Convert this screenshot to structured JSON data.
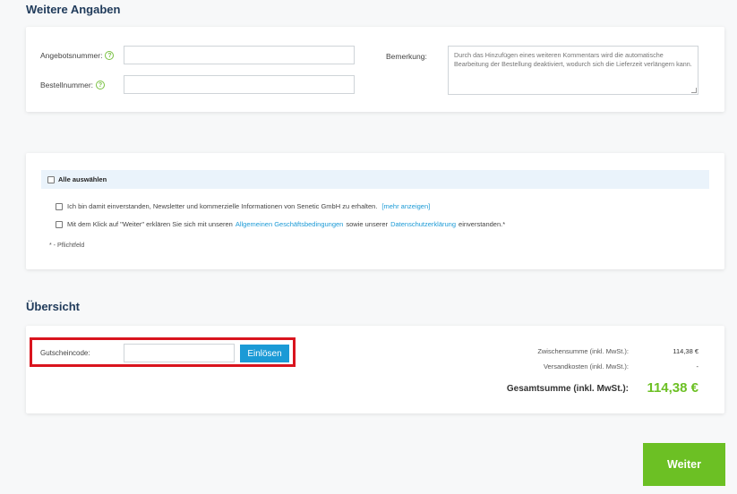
{
  "additional_info": {
    "title": "Weitere Angaben",
    "offer_number_label": "Angebotsnummer:",
    "order_number_label": "Bestellnummer:",
    "help_glyph": "?",
    "remark_label": "Bemerkung:",
    "remark_placeholder": "Durch das Hinzufügen eines weiteren Kommentars wird die automatische Bearbeitung der Bestellung deaktiviert, wodurch sich die Lieferzeit verlängern kann."
  },
  "consents": {
    "select_all": "Alle auswählen",
    "newsletter_text": "Ich bin damit einverstanden, Newsletter und kommerzielle Informationen von Senetic GmbH zu erhalten.",
    "newsletter_more": "[mehr anzeigen]",
    "terms_prefix": "Mit dem Klick auf \"Weiter\" erklären Sie sich mit unseren",
    "terms_link": "Allgemeinen Geschäftsbedingungen",
    "terms_middle": "sowie unserer",
    "privacy_link": "Datenschutzerklärung",
    "terms_suffix": "einverstanden.*",
    "required_note": "* - Pflichtfeld"
  },
  "overview": {
    "title": "Übersicht",
    "voucher_label": "Gutscheincode:",
    "redeem_button": "Einlösen",
    "subtotal_label": "Zwischensumme (inkl. MwSt.):",
    "subtotal_value": "114,38 €",
    "shipping_label": "Versandkosten (inkl. MwSt.):",
    "shipping_value": "-",
    "total_label": "Gesamtsumme (inkl. MwSt.):",
    "total_value": "114,38 €"
  },
  "next_button": "Weiter",
  "colors": {
    "accent_blue": "#1b9ad6",
    "accent_green": "#6cc024",
    "highlight_red": "#d9141e",
    "title_navy": "#1f3a5a"
  }
}
